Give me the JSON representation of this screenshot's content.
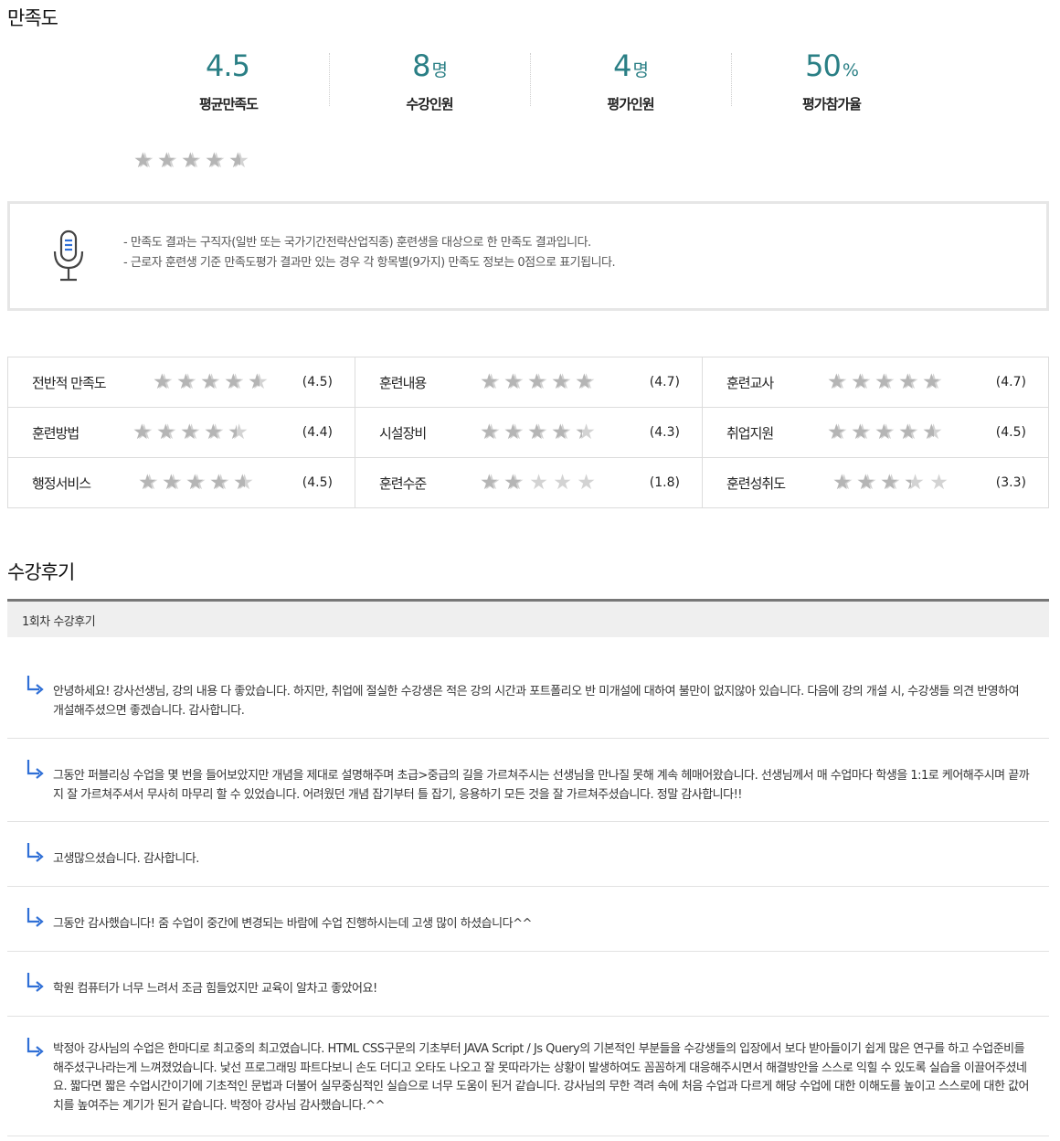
{
  "satisfaction": {
    "title": "만족도",
    "stats": [
      {
        "value": "4.5",
        "unit": "",
        "label": "평균만족도"
      },
      {
        "value": "8",
        "unit": "명",
        "label": "수강인원"
      },
      {
        "value": "4",
        "unit": "명",
        "label": "평가인원"
      },
      {
        "value": "50",
        "unit": "%",
        "label": "평가참가율"
      }
    ],
    "average_stars": 4.5
  },
  "notice": {
    "icon": "microphone-icon",
    "lines": [
      "- 만족도 결과는 구직자(일반 또는 국가기간전략산업직종) 훈련생을 대상으로 한 만족도 결과입니다.",
      "- 근로자 훈련생 기준 만족도평가 결과만 있는 경우 각 항목별(9가지) 만족도 정보는 0점으로 표기됩니다."
    ]
  },
  "ratings": [
    {
      "label": "전반적 만족도",
      "score": 4.5,
      "score_text": "(4.5)"
    },
    {
      "label": "훈련내용",
      "score": 4.7,
      "score_text": "(4.7)"
    },
    {
      "label": "훈련교사",
      "score": 4.7,
      "score_text": "(4.7)"
    },
    {
      "label": "훈련방법",
      "score": 4.4,
      "score_text": "(4.4)"
    },
    {
      "label": "시설장비",
      "score": 4.3,
      "score_text": "(4.3)"
    },
    {
      "label": "취업지원",
      "score": 4.5,
      "score_text": "(4.5)"
    },
    {
      "label": "행정서비스",
      "score": 4.5,
      "score_text": "(4.5)"
    },
    {
      "label": "훈련수준",
      "score": 1.8,
      "score_text": "(1.8)"
    },
    {
      "label": "훈련성취도",
      "score": 3.3,
      "score_text": "(3.3)"
    }
  ],
  "reviews_section": {
    "title": "수강후기",
    "tab": "1회차 수강후기",
    "reviews": [
      "안녕하세요! 강사선생님, 강의 내용 다 좋았습니다. 하지만, 취업에 절실한 수강생은 적은 강의 시간과 포트폴리오 반 미개설에 대하여 불만이 없지않아 있습니다. 다음에 강의 개설 시, 수강생들 의견 반영하여 개설해주셨으면 좋겠습니다. 감사합니다.",
      "그동안 퍼블리싱 수업을 몇 번을 들어보았지만 개념을 제대로 설명해주며 초급>중급의 길을 가르쳐주시는 선생님을 만나질 못해 계속 헤매어왔습니다. 선생님께서 매 수업마다 학생을 1:1로 케어해주시며 끝까지 잘 가르쳐주셔서 무사히 마무리 할 수 있었습니다. 어려웠던 개념 잡기부터 틀 잡기, 응용하기 모든 것을 잘 가르쳐주셨습니다. 정말 감사합니다!!",
      "고생많으셨습니다. 감사합니다.",
      "그동안 감사했습니다! 줌 수업이 중간에 변경되는 바람에 수업 진행하시는데 고생 많이 하셨습니다^^",
      "학원 컴퓨터가 너무 느려서 조금 힘들었지만 교육이 알차고 좋았어요!",
      "박정아 강사님의 수업은 한마디로 최고중의 최고였습니다. HTML CSS구문의 기초부터 JAVA Script / Js Query의 기본적인 부분들을 수강생들의 입장에서 보다 받아들이기 쉽게 많은 연구를 하고 수업준비를 해주셨구나라는게 느껴졌었습니다. 낯선 프로그래밍 파트다보니 손도 더디고 오타도 나오고 잘 못따라가는 상황이 발생하여도 꼼꼼하게 대응해주시면서 해결방안을 스스로 익힐 수 있도록 실습을 이끌어주셨네요. 짧다면 짧은 수업시간이기에 기초적인 문법과 더불어 실무중심적인 실습으로 너무 도움이 된거 같습니다. 강사님의 무한 격려 속에 처음 수업과 다르게 해당 수업에 대한 이해도를 높이고 스스로에 대한 값어치를 높여주는 계기가 된거 같습니다. 박정아 강사님 감사했습니다.^^"
    ]
  }
}
